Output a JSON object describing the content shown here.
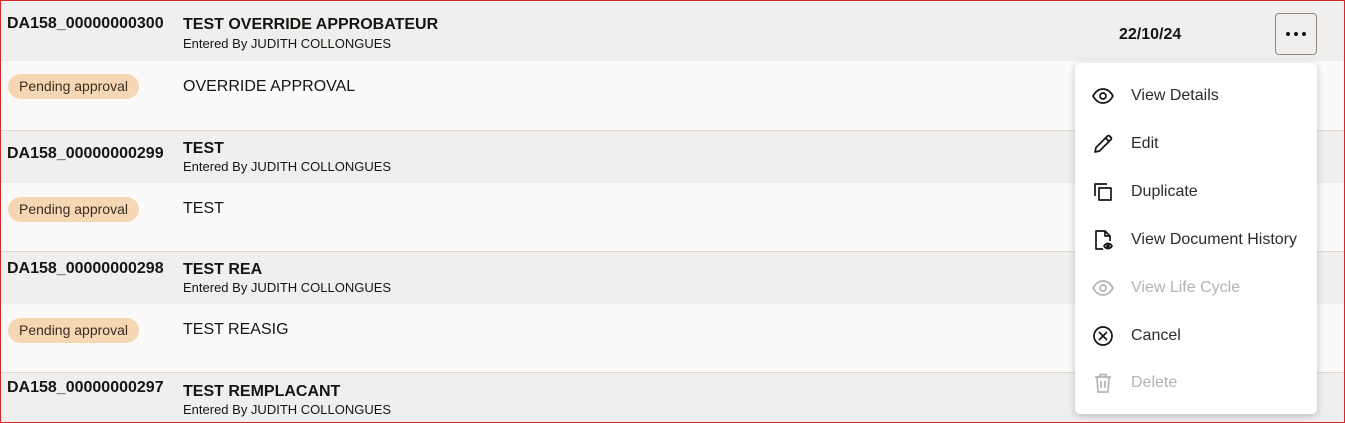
{
  "records": [
    {
      "id": "DA158_00000000300",
      "title": "TEST OVERRIDE APPROBATEUR",
      "entered_by": "Entered By JUDITH COLLONGUES",
      "status": "Pending approval",
      "description": "OVERRIDE APPROVAL",
      "date": "22/10/24"
    },
    {
      "id": "DA158_00000000299",
      "title": "TEST",
      "entered_by": "Entered By JUDITH COLLONGUES",
      "status": "Pending approval",
      "description": "TEST"
    },
    {
      "id": "DA158_00000000298",
      "title": "TEST REA",
      "entered_by": "Entered By JUDITH COLLONGUES",
      "status": "Pending approval",
      "description": "TEST REASIG"
    },
    {
      "id": "DA158_00000000297",
      "title": "TEST REMPLACANT",
      "entered_by": "Entered By JUDITH COLLONGUES"
    }
  ],
  "actions_menu": {
    "items": [
      {
        "label": "View Details",
        "icon": "eye-icon",
        "enabled": true
      },
      {
        "label": "Edit",
        "icon": "pencil-icon",
        "enabled": true
      },
      {
        "label": "Duplicate",
        "icon": "duplicate-icon",
        "enabled": true
      },
      {
        "label": "View Document History",
        "icon": "document-history-icon",
        "enabled": true
      },
      {
        "label": "View Life Cycle",
        "icon": "eye-icon",
        "enabled": false
      },
      {
        "label": "Cancel",
        "icon": "cancel-circle-icon",
        "enabled": true
      },
      {
        "label": "Delete",
        "icon": "trash-icon",
        "enabled": false
      }
    ]
  },
  "colors": {
    "border_highlight": "#d6272a",
    "badge_bg": "#f5d7b4",
    "row_header_bg": "#f1efed",
    "disabled_text": "#b7b3ae"
  }
}
